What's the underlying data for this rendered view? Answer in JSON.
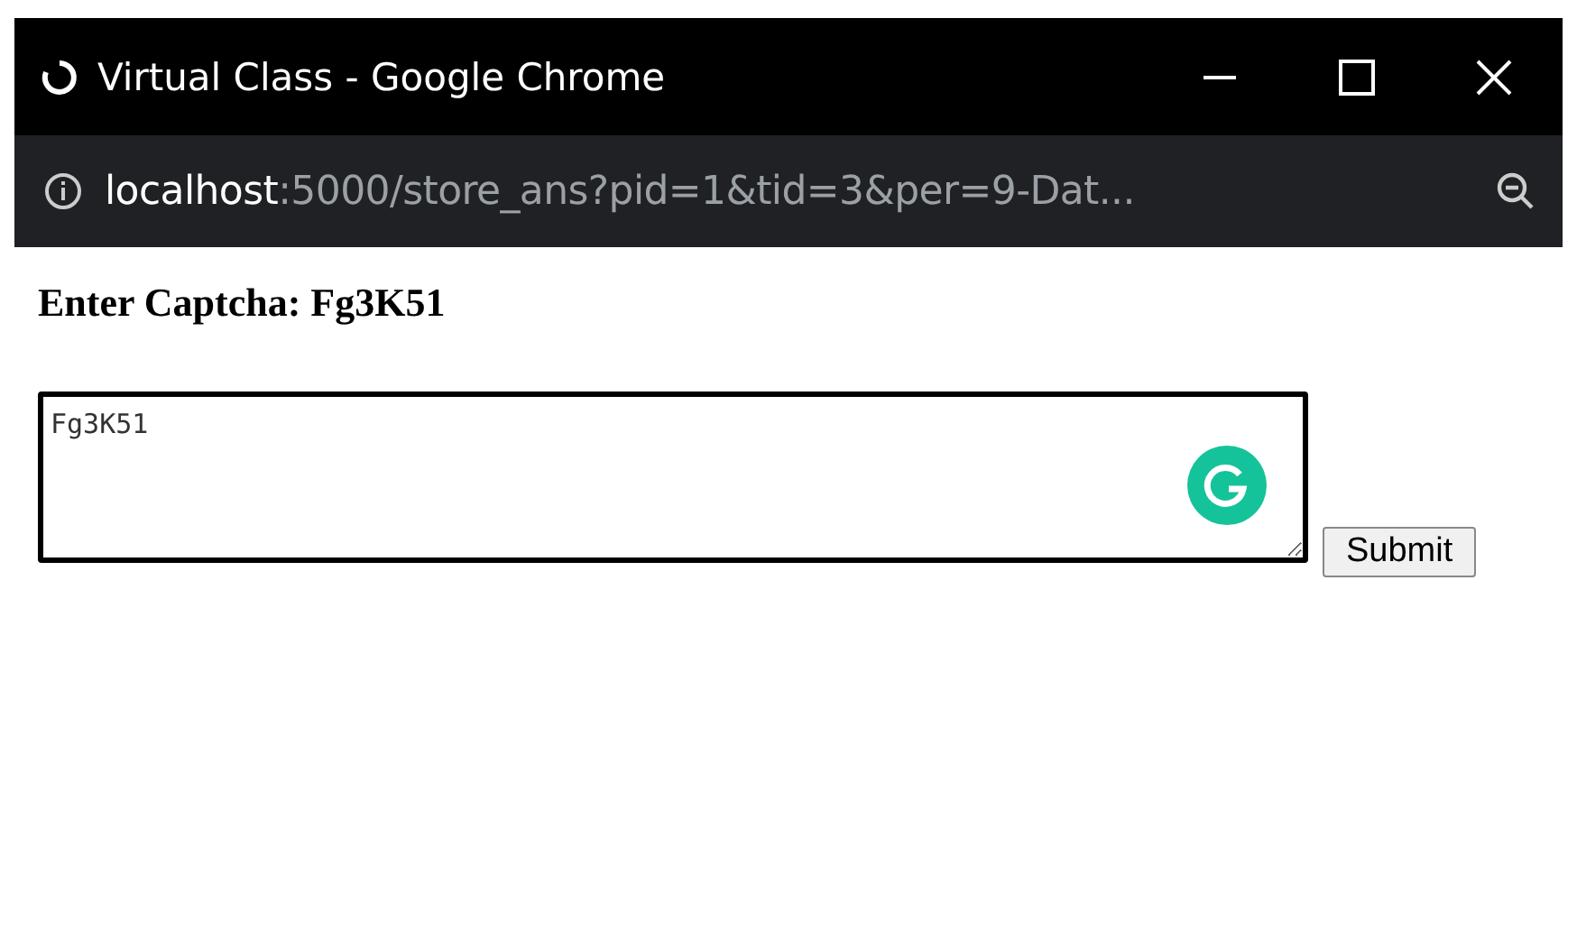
{
  "window": {
    "title": "Virtual Class - Google Chrome",
    "loading": true
  },
  "address_bar": {
    "host": "localhost",
    "path": ":5000/store_ans?pid=1&tid=3&per=9-Dat..."
  },
  "page": {
    "heading": "Enter Captcha: Fg3K51",
    "answer": {
      "value": "Fg3K51"
    },
    "submit": "Submit"
  }
}
